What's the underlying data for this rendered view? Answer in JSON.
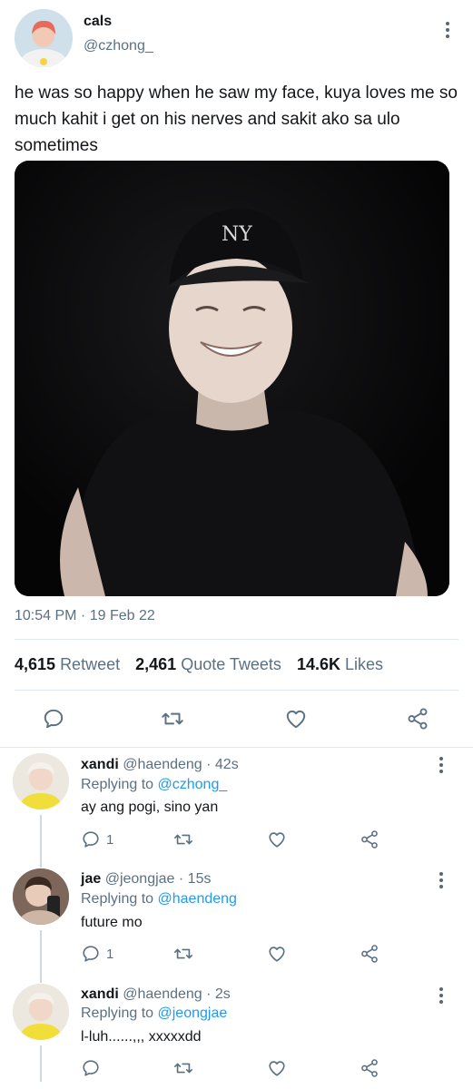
{
  "tweet": {
    "display_name": "cals",
    "handle": "@czhong_",
    "text": "he was so happy when he saw my face, kuya loves me so much kahit i get on his nerves and sakit ako sa ulo sometimes",
    "timestamp": "10:54 PM · 19 Feb 22",
    "stats": {
      "retweets_count": "4,615",
      "retweets_label": "Retweet",
      "quotes_count": "2,461",
      "quotes_label": "Quote Tweets",
      "likes_count": "14.6K",
      "likes_label": "Likes"
    }
  },
  "replies": [
    {
      "display_name": "xandi",
      "meta": "@haendeng · 42s",
      "replying_prefix": "Replying to ",
      "replying_to": "@czhong_",
      "text": "ay ang pogi, sino yan",
      "reply_count": "1"
    },
    {
      "display_name": "jae",
      "meta": "@jeongjae · 15s",
      "replying_prefix": "Replying to ",
      "replying_to": "@haendeng",
      "text": "future mo",
      "reply_count": "1"
    },
    {
      "display_name": "xandi",
      "meta": "@haendeng · 2s",
      "replying_prefix": "Replying to ",
      "replying_to": "@jeongjae",
      "text": "l-luh......,,, xxxxxdd",
      "reply_count": ""
    }
  ],
  "icons": [
    "reply-icon",
    "retweet-icon",
    "like-icon",
    "share-icon",
    "more-icon"
  ],
  "colors": {
    "link": "#1d9bf0",
    "secondary_text": "#5b7083",
    "divider": "#e1e8ed"
  }
}
